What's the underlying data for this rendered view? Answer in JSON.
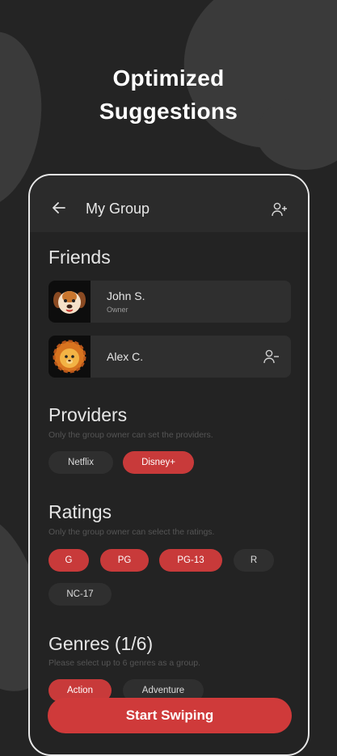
{
  "headline": {
    "line1": "Optimized",
    "line2": "Suggestions"
  },
  "appbar": {
    "title": "My Group"
  },
  "friends": {
    "title": "Friends",
    "items": [
      {
        "name": "John S.",
        "role": "Owner",
        "avatar": "dog-emoji-avatar"
      },
      {
        "name": "Alex C.",
        "role": "",
        "avatar": "lion-emoji-avatar"
      }
    ]
  },
  "providers": {
    "title": "Providers",
    "subtitle": "Only the group owner can set the providers.",
    "chips": [
      {
        "label": "Netflix",
        "selected": false
      },
      {
        "label": "Disney+",
        "selected": true
      }
    ]
  },
  "ratings": {
    "title": "Ratings",
    "subtitle": "Only the group owner can select the ratings.",
    "chips": [
      {
        "label": "G",
        "selected": true
      },
      {
        "label": "PG",
        "selected": true
      },
      {
        "label": "PG-13",
        "selected": true
      },
      {
        "label": "R",
        "selected": false
      },
      {
        "label": "NC-17",
        "selected": false
      }
    ]
  },
  "genres": {
    "title": "Genres (1/6)",
    "subtitle": "Please select up to 6 genres as a group.",
    "chips": [
      {
        "label": "Action",
        "selected": true
      },
      {
        "label": "Adventure",
        "selected": false
      }
    ]
  },
  "start_button": {
    "label": "Start Swiping"
  },
  "colors": {
    "accent": "#cf3a3a",
    "background": "#242424",
    "card": "#2f2f2f"
  }
}
